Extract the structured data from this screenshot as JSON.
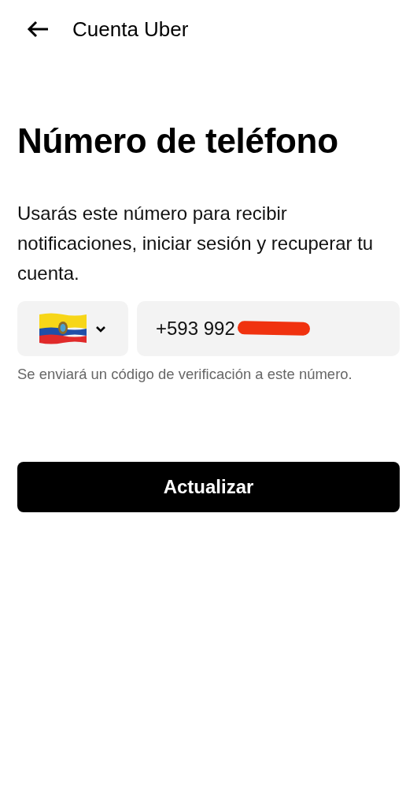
{
  "header": {
    "title": "Cuenta Uber"
  },
  "title": "Número de teléfono",
  "description": "Usarás este número para recibir notificaciones, iniciar sesión y recuperar tu cuenta.",
  "phone": {
    "value": "+593 992",
    "redacted": true
  },
  "hint": "Se enviará un código de verificación a este número.",
  "button": "Actualizar"
}
